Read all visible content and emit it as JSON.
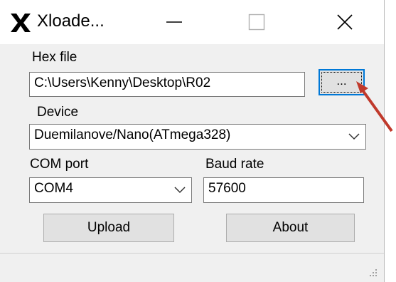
{
  "window": {
    "title": "Xloade...",
    "icons": {
      "app": "x-logo-icon",
      "minimize": "minimize-icon",
      "maximize": "maximize-icon",
      "close": "close-icon"
    }
  },
  "hex_file": {
    "label": "Hex file",
    "value": "C:\\Users\\Kenny\\Desktop\\R02",
    "browse_label": "..."
  },
  "device": {
    "label": "Device",
    "selected": "Duemilanove/Nano(ATmega328)"
  },
  "com_port": {
    "label": "COM port",
    "selected": "COM4"
  },
  "baud_rate": {
    "label": "Baud rate",
    "value": "57600"
  },
  "buttons": {
    "upload": "Upload",
    "about": "About"
  },
  "colors": {
    "focus_border": "#0078d7",
    "annotation_arrow": "#c0392b"
  }
}
